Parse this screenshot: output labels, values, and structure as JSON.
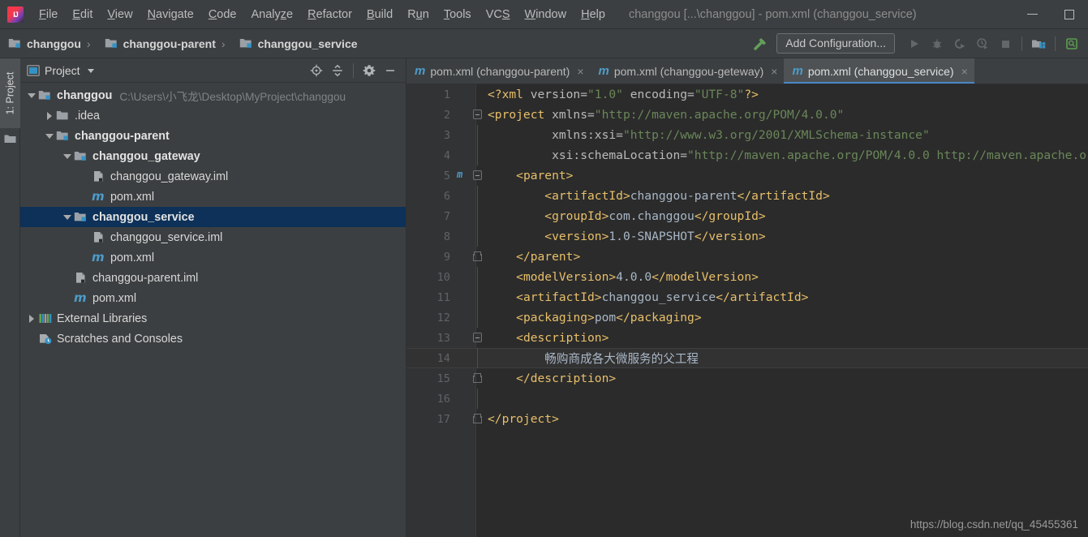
{
  "window": {
    "title": "changgou [...\\changgou] - pom.xml (changgou_service)",
    "logo_icon": "intellij-idea-logo",
    "minimize_label": "minimize-window",
    "maximize_label": "maximize-window"
  },
  "menu": {
    "items": [
      {
        "label": "File",
        "mnemonic": "F"
      },
      {
        "label": "Edit",
        "mnemonic": "E"
      },
      {
        "label": "View",
        "mnemonic": "V"
      },
      {
        "label": "Navigate",
        "mnemonic": "N"
      },
      {
        "label": "Code",
        "mnemonic": "C"
      },
      {
        "label": "Analyze",
        "mnemonic": "z"
      },
      {
        "label": "Refactor",
        "mnemonic": "R"
      },
      {
        "label": "Build",
        "mnemonic": "B"
      },
      {
        "label": "Run",
        "mnemonic": "u"
      },
      {
        "label": "Tools",
        "mnemonic": "T"
      },
      {
        "label": "VCS",
        "mnemonic": "S"
      },
      {
        "label": "Window",
        "mnemonic": "W"
      },
      {
        "label": "Help",
        "mnemonic": "H"
      }
    ]
  },
  "navbar": {
    "crumbs": [
      {
        "label": "changgou",
        "icon": "module-folder-icon"
      },
      {
        "label": "changgou-parent",
        "icon": "module-folder-icon"
      },
      {
        "label": "changgou_service",
        "icon": "module-folder-icon"
      }
    ],
    "separator": "›",
    "build_icon": "hammer-build-icon",
    "add_configuration_label": "Add Configuration...",
    "run_icon": "run-icon",
    "debug_icon": "debug-icon",
    "coverage_icon": "run-with-coverage-icon",
    "profile_icon": "profiler-icon",
    "stop_icon": "stop-icon",
    "project_structure_icon": "project-structure-icon",
    "search_icon": "search-everywhere-icon"
  },
  "toolstrip": {
    "project_tab_label": "1: Project",
    "favorites_icon": "favorites-folder-icon"
  },
  "project_panel": {
    "title": "Project",
    "view_icon": "project-view-icon",
    "dropdown_icon": "chevron-down-icon",
    "locate_icon": "locate-file-icon",
    "collapse_icon": "collapse-all-icon",
    "settings_icon": "gear-icon",
    "hide_icon": "hide-panel-icon",
    "tree": [
      {
        "label": "changgou",
        "path": "C:\\Users\\小飞龙\\Desktop\\MyProject\\changgou",
        "depth": 0,
        "twist": "down",
        "icon": "module-folder-icon",
        "bold": true,
        "selected": false
      },
      {
        "label": ".idea",
        "path": "",
        "depth": 1,
        "twist": "right",
        "icon": "folder-icon",
        "bold": false,
        "selected": false
      },
      {
        "label": "changgou-parent",
        "path": "",
        "depth": 1,
        "twist": "down",
        "icon": "module-folder-icon",
        "bold": true,
        "selected": false
      },
      {
        "label": "changgou_gateway",
        "path": "",
        "depth": 2,
        "twist": "down",
        "icon": "module-folder-icon",
        "bold": true,
        "selected": false
      },
      {
        "label": "changgou_gateway.iml",
        "path": "",
        "depth": 3,
        "twist": "none",
        "icon": "iml-file-icon",
        "bold": false,
        "selected": false
      },
      {
        "label": "pom.xml",
        "path": "",
        "depth": 3,
        "twist": "none",
        "icon": "maven-pom-icon",
        "bold": false,
        "selected": false
      },
      {
        "label": "changgou_service",
        "path": "",
        "depth": 2,
        "twist": "down",
        "icon": "module-folder-icon",
        "bold": true,
        "selected": true
      },
      {
        "label": "changgou_service.iml",
        "path": "",
        "depth": 3,
        "twist": "none",
        "icon": "iml-file-icon",
        "bold": false,
        "selected": false
      },
      {
        "label": "pom.xml",
        "path": "",
        "depth": 3,
        "twist": "none",
        "icon": "maven-pom-icon",
        "bold": false,
        "selected": false
      },
      {
        "label": "changgou-parent.iml",
        "path": "",
        "depth": 2,
        "twist": "none",
        "icon": "iml-file-icon",
        "bold": false,
        "selected": false
      },
      {
        "label": "pom.xml",
        "path": "",
        "depth": 2,
        "twist": "none",
        "icon": "maven-pom-icon",
        "bold": false,
        "selected": false
      },
      {
        "label": "External Libraries",
        "path": "",
        "depth": 0,
        "twist": "right",
        "icon": "libraries-icon",
        "bold": false,
        "selected": false
      },
      {
        "label": "Scratches and Consoles",
        "path": "",
        "depth": 0,
        "twist": "none",
        "icon": "scratches-icon",
        "bold": false,
        "selected": false
      }
    ]
  },
  "editor": {
    "tabs": [
      {
        "label": "pom.xml (changgou-parent)",
        "icon": "maven-pom-icon",
        "active": false,
        "close_icon": "close-icon"
      },
      {
        "label": "pom.xml (changgou-geteway)",
        "icon": "maven-pom-icon",
        "active": false,
        "close_icon": "close-icon"
      },
      {
        "label": "pom.xml (changgou_service)",
        "icon": "maven-pom-icon",
        "active": true,
        "close_icon": "close-icon"
      }
    ],
    "current_line": 14,
    "lines": [
      {
        "n": 1,
        "fold": "none",
        "gutter": "none",
        "html": "<span class=\"pi2\">&lt;?xml </span><span class=\"an\">version=</span><span class=\"st\">\"1.0\"</span><span class=\"an\"> encoding=</span><span class=\"st\">\"UTF-8\"</span><span class=\"pi2\">?&gt;</span>"
      },
      {
        "n": 2,
        "fold": "start",
        "gutter": "none",
        "html": "<span class=\"tg\">&lt;project </span><span class=\"an\">xmlns=</span><span class=\"st\">\"http://maven.apache.org/POM/4.0.0\"</span>"
      },
      {
        "n": 3,
        "fold": "none",
        "gutter": "none",
        "html": "         <span class=\"an\">xmlns:xsi=</span><span class=\"st\">\"http://www.w3.org/2001/XMLSchema-instance\"</span>"
      },
      {
        "n": 4,
        "fold": "none",
        "gutter": "none",
        "html": "         <span class=\"an\">xsi:schemaLocation=</span><span class=\"st\">\"http://maven.apache.org/POM/4.0.0 http://maven.apache.or</span>"
      },
      {
        "n": 5,
        "fold": "start",
        "gutter": "maven",
        "html": "    <span class=\"tg\">&lt;parent&gt;</span>"
      },
      {
        "n": 6,
        "fold": "none",
        "gutter": "none",
        "html": "        <span class=\"tg\">&lt;artifactId&gt;</span><span class=\"tx\">changgou-parent</span><span class=\"tg\">&lt;/artifactId&gt;</span>"
      },
      {
        "n": 7,
        "fold": "none",
        "gutter": "none",
        "html": "        <span class=\"tg\">&lt;groupId&gt;</span><span class=\"tx\">com.changgou</span><span class=\"tg\">&lt;/groupId&gt;</span>"
      },
      {
        "n": 8,
        "fold": "none",
        "gutter": "none",
        "html": "        <span class=\"tg\">&lt;version&gt;</span><span class=\"tx\">1.0-SNAPSHOT</span><span class=\"tg\">&lt;/version&gt;</span>"
      },
      {
        "n": 9,
        "fold": "end",
        "gutter": "none",
        "html": "    <span class=\"tg\">&lt;/parent&gt;</span>"
      },
      {
        "n": 10,
        "fold": "none",
        "gutter": "none",
        "html": "    <span class=\"tg\">&lt;modelVersion&gt;</span><span class=\"tx\">4.0.0</span><span class=\"tg\">&lt;/modelVersion&gt;</span>"
      },
      {
        "n": 11,
        "fold": "none",
        "gutter": "none",
        "html": "    <span class=\"tg\">&lt;artifactId&gt;</span><span class=\"tx\">changgou_service</span><span class=\"tg\">&lt;/artifactId&gt;</span>"
      },
      {
        "n": 12,
        "fold": "none",
        "gutter": "none",
        "html": "    <span class=\"tg\">&lt;packaging&gt;</span><span class=\"tx\">pom</span><span class=\"tg\">&lt;/packaging&gt;</span>"
      },
      {
        "n": 13,
        "fold": "start",
        "gutter": "none",
        "html": "    <span class=\"tg\">&lt;description&gt;</span>"
      },
      {
        "n": 14,
        "fold": "none",
        "gutter": "none",
        "html": "        <span class=\"cjk\">畅购商成各大微服务的父工程</span>"
      },
      {
        "n": 15,
        "fold": "end",
        "gutter": "none",
        "html": "    <span class=\"tg\">&lt;/description&gt;</span>"
      },
      {
        "n": 16,
        "fold": "none",
        "gutter": "none",
        "html": ""
      },
      {
        "n": 17,
        "fold": "end",
        "gutter": "none",
        "html": "<span class=\"tg\">&lt;/project&gt;</span>"
      }
    ],
    "raw_text": [
      "<?xml version=\"1.0\" encoding=\"UTF-8\"?>",
      "<project xmlns=\"http://maven.apache.org/POM/4.0.0\"",
      "         xmlns:xsi=\"http://www.w3.org/2001/XMLSchema-instance\"",
      "         xsi:schemaLocation=\"http://maven.apache.org/POM/4.0.0 http://maven.apache.or",
      "    <parent>",
      "        <artifactId>changgou-parent</artifactId>",
      "        <groupId>com.changgou</groupId>",
      "        <version>1.0-SNAPSHOT</version>",
      "    </parent>",
      "    <modelVersion>4.0.0</modelVersion>",
      "    <artifactId>changgou_service</artifactId>",
      "    <packaging>pom</packaging>",
      "    <description>",
      "        畅购商成各大微服务的父工程",
      "    </description>",
      "",
      "</project>"
    ]
  },
  "watermark": "https://blog.csdn.net/qq_45455361",
  "colors": {
    "chrome_bg": "#3c3f41",
    "editor_bg": "#2b2b2b",
    "gutter_bg": "#313335",
    "selection_blue": "#0d3158",
    "tab_active": "#4e5254",
    "tab_underline": "#4a88c7",
    "xml_tag": "#e8bf6a",
    "xml_string": "#6a8759",
    "text_fg": "#a9b7c6",
    "maven_blue": "#4c9ccb"
  }
}
